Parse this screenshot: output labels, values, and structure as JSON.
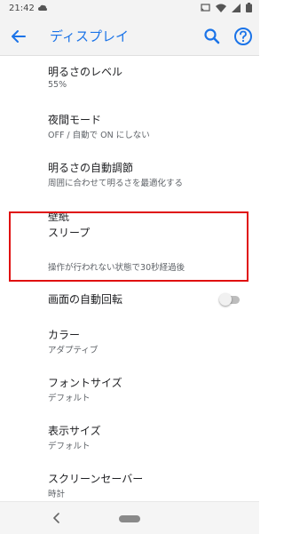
{
  "status_bar": {
    "time": "21:42",
    "icons": [
      "cloud-icon",
      "cast-icon",
      "wifi-icon",
      "signal-icon",
      "battery-icon"
    ]
  },
  "app_bar": {
    "title": "ディスプレイ",
    "back_icon": "arrow-back-icon",
    "search_icon": "search-icon",
    "help_icon": "help-icon",
    "accent_color": "#1a73e8"
  },
  "settings": {
    "brightness": {
      "title": "明るさのレベル",
      "subtitle": "55%"
    },
    "night_mode": {
      "title": "夜間モード",
      "subtitle": "OFF / 自動で ON にしない"
    },
    "adaptive_brightness": {
      "title": "明るさの自動調節",
      "subtitle": "周囲に合わせて明るさを最適化する"
    },
    "wallpaper": {
      "title": "壁紙"
    },
    "sleep": {
      "title": "スリープ",
      "subtitle": "操作が行われない状態で30秒経過後",
      "highlighted": true,
      "highlight_color": "#e01010"
    },
    "auto_rotate": {
      "title": "画面の自動回転",
      "toggle_on": false
    },
    "color": {
      "title": "カラー",
      "subtitle": "アダプティブ"
    },
    "font_size": {
      "title": "フォントサイズ",
      "subtitle": "デフォルト"
    },
    "display_size": {
      "title": "表示サイズ",
      "subtitle": "デフォルト"
    },
    "screensaver": {
      "title": "スクリーンセーバー",
      "subtitle": "時計"
    }
  },
  "nav_bar": {
    "back_icon": "nav-back-icon",
    "home_icon": "home-pill-icon"
  }
}
